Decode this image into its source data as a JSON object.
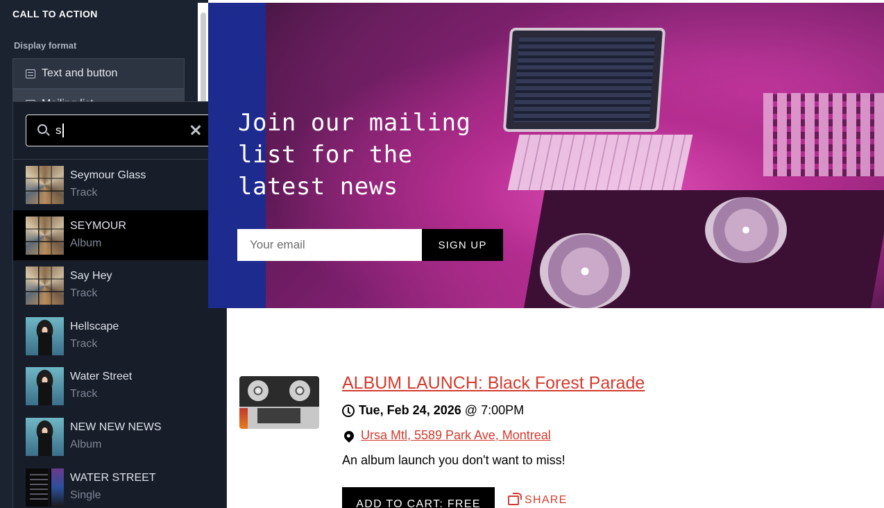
{
  "editor": {
    "section_title": "CALL TO ACTION",
    "display_format_label": "Display format",
    "options": [
      {
        "label": "Text and button",
        "icon": "text-layout-icon"
      },
      {
        "label": "Mailing list",
        "icon": "text-layout-icon"
      }
    ]
  },
  "search": {
    "value": "s",
    "placeholder": "",
    "icon": "search-icon",
    "clear_icon": "close-icon",
    "results": [
      {
        "title": "Seymour Glass",
        "type": "Track",
        "art": "collage"
      },
      {
        "title": "SEYMOUR",
        "type": "Album",
        "art": "collage",
        "selected": true
      },
      {
        "title": "Say Hey",
        "type": "Track",
        "art": "collage"
      },
      {
        "title": "Hellscape",
        "type": "Track",
        "art": "person"
      },
      {
        "title": "Water Street",
        "type": "Track",
        "art": "person"
      },
      {
        "title": "NEW NEW NEWS",
        "type": "Album",
        "art": "person"
      },
      {
        "title": "WATER STREET",
        "type": "Single",
        "art": "single"
      }
    ]
  },
  "hero": {
    "headline": "Join our mailing list for the latest news",
    "email_placeholder": "Your email",
    "signup_label": "SIGN UP",
    "accent_blue": "#1d2a8e"
  },
  "event": {
    "title": "ALBUM LAUNCH: Black Forest Parade",
    "date": "Tue, Feb 24, 2026",
    "time_sep": "@",
    "time": "7:00PM",
    "location": "Ursa Mtl, 5589 Park Ave, Montreal",
    "description": "An album launch you don't want to miss!",
    "cart_label": "ADD TO CART: FREE",
    "share_label": "SHARE",
    "link_color": "#d33a2c"
  }
}
